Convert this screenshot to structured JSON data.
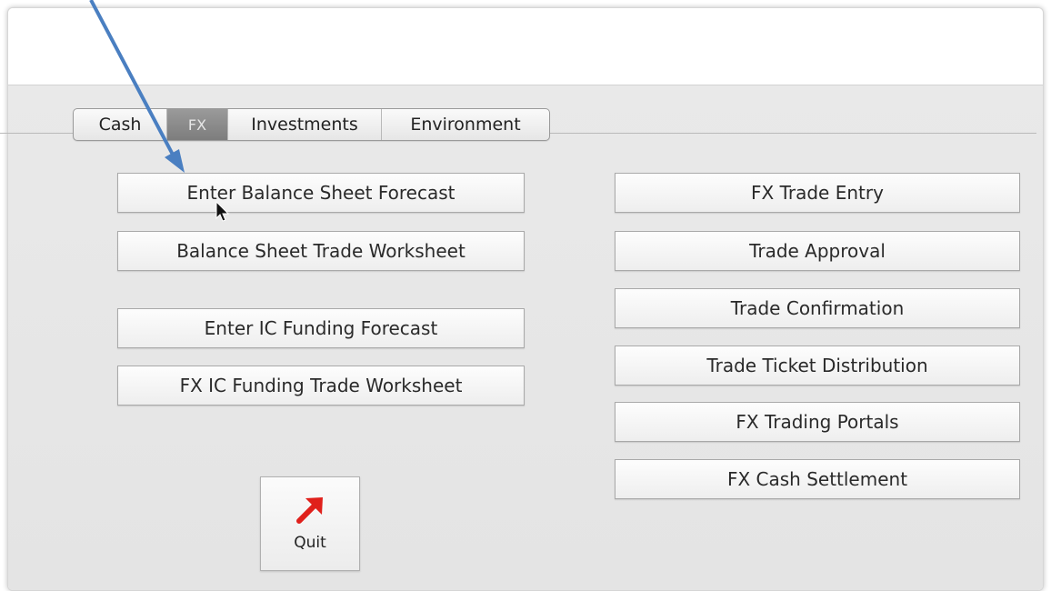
{
  "tabs": [
    "Cash",
    "FX",
    "Investments",
    "Environment"
  ],
  "active_tab": "FX",
  "left_buttons": [
    "Enter Balance Sheet Forecast",
    "Balance Sheet Trade Worksheet",
    "Enter IC Funding Forecast",
    "FX IC Funding Trade Worksheet"
  ],
  "right_buttons": [
    "FX Trade Entry",
    "Trade Approval",
    "Trade Confirmation",
    "Trade Ticket Distribution",
    "FX Trading Portals",
    "FX Cash Settlement"
  ],
  "quit_label": "Quit",
  "icons": {
    "quit": "red-diagonal-arrow-icon",
    "cursor": "mouse-pointer-icon",
    "annotation": "blue-annotation-arrow"
  },
  "colors": {
    "panel_bg": "#e7e7e7",
    "active_tab": "#8a8a8a",
    "annotation_arrow": "#4a7fc1",
    "quit_arrow": "#e0201b"
  }
}
